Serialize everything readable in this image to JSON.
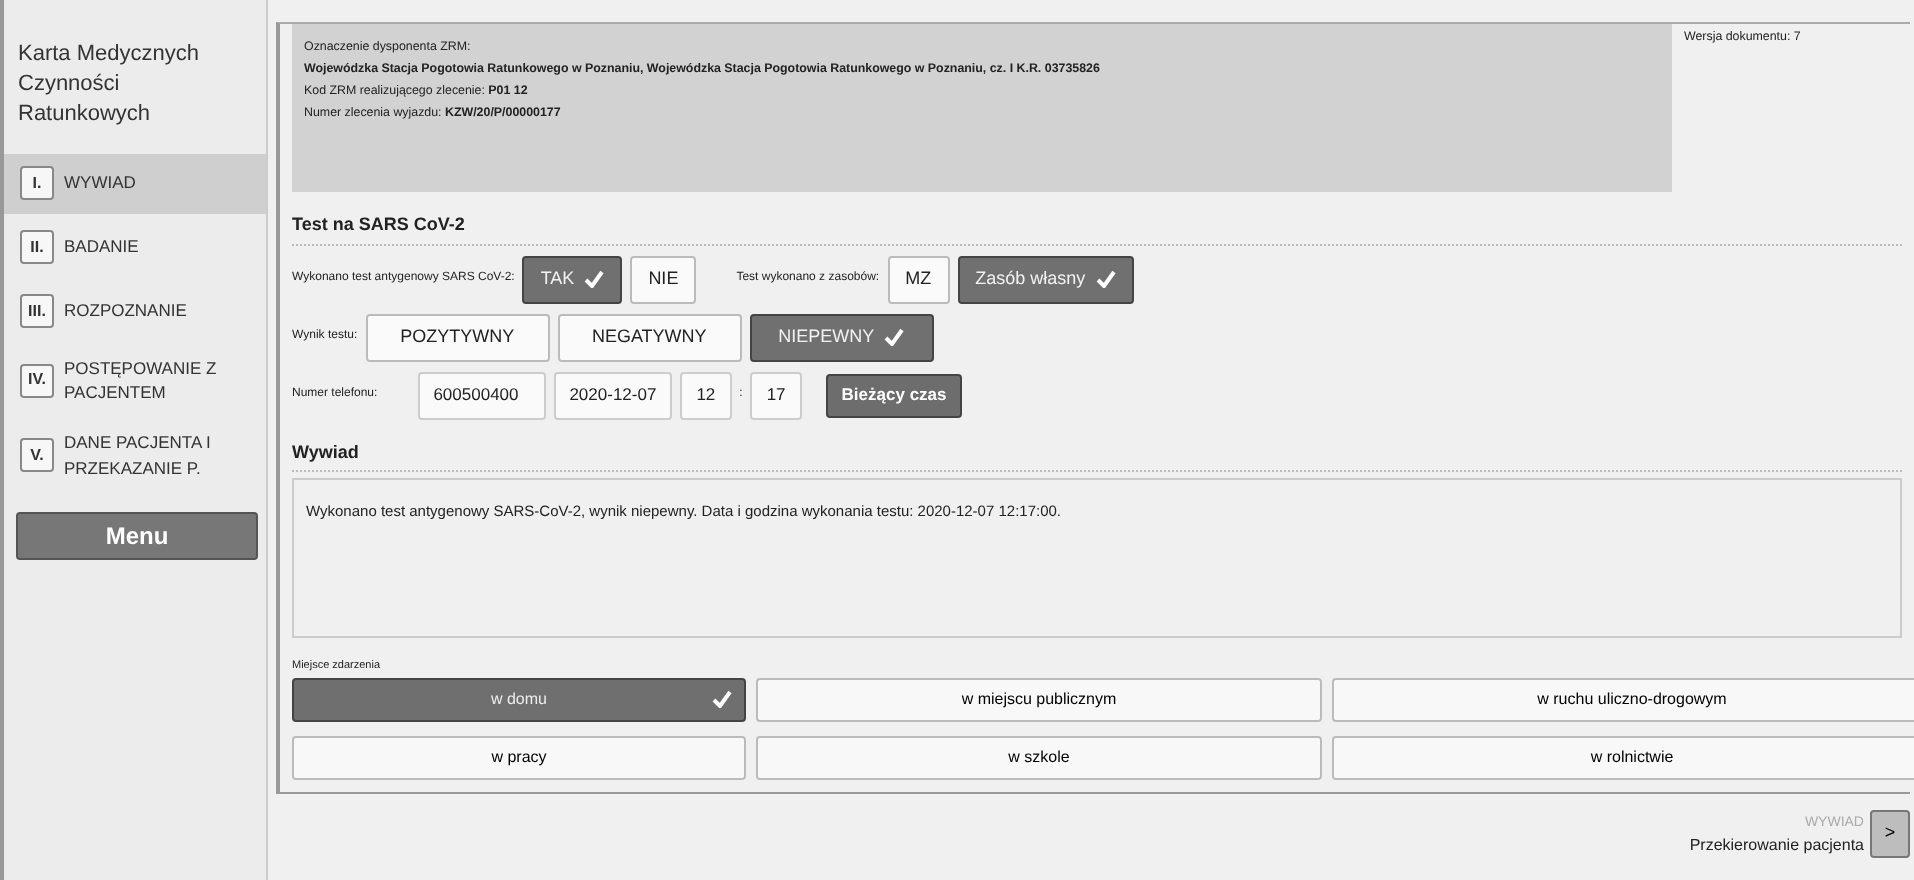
{
  "sidebar": {
    "title": "Karta Medycznych Czynności Ratunkowych",
    "items": [
      {
        "number": "I.",
        "label": "WYWIAD",
        "selected": true
      },
      {
        "number": "II.",
        "label": "BADANIE",
        "selected": false
      },
      {
        "number": "III.",
        "label": "ROZPOZNANIE",
        "selected": false
      },
      {
        "number": "IV.",
        "label": "POSTĘPOWANIE Z PACJENTEM",
        "selected": false
      },
      {
        "number": "V.",
        "label": "DANE PACJENTA I PRZEKAZANIE P.",
        "selected": false
      }
    ],
    "menu_button": "Menu"
  },
  "header": {
    "dispatcher_label": "Oznaczenie dysponenta ZRM:",
    "dispatcher_value": "Wojewódzka Stacja Pogotowia Ratunkowego w Poznaniu, Wojewódzka Stacja Pogotowia Ratunkowego w Poznaniu, cz. I K.R. 03735826",
    "zrm_code_label": "Kod ZRM realizującego zlecenie:",
    "zrm_code_value": "P01 12",
    "order_label": "Numer zlecenia wyjazdu:",
    "order_value": "KZW/20/P/00000177",
    "version": "Wersja dokumentu: 7"
  },
  "test": {
    "title": "Test na SARS CoV-2",
    "antigen_label": "Wykonano test antygenowy SARS CoV-2:",
    "antigen_options": [
      {
        "label": "TAK",
        "selected": true
      },
      {
        "label": "NIE",
        "selected": false
      }
    ],
    "resource_label": "Test wykonano z zasobów:",
    "resource_options": [
      {
        "label": "MZ",
        "selected": false
      },
      {
        "label": "Zasób własny",
        "selected": true
      }
    ],
    "result_label": "Wynik testu:",
    "result_options": [
      {
        "label": "POZYTYWNY",
        "selected": false
      },
      {
        "label": "NEGATYWNY",
        "selected": false
      },
      {
        "label": "NIEPEWNY",
        "selected": true
      }
    ],
    "phone_label": "Numer telefonu:",
    "phone_value": "600500400",
    "date": "2020-12-07",
    "hour": "12",
    "time_separator": ":",
    "minute": "17",
    "current_time_button": "Bieżący czas"
  },
  "interview": {
    "title": "Wywiad",
    "text": "Wykonano test antygenowy SARS-CoV-2, wynik niepewny. Data i godzina wykonania testu: 2020-12-07 12:17:00."
  },
  "location": {
    "label": "Miejsce zdarzenia",
    "options": [
      {
        "label": "w domu",
        "selected": true
      },
      {
        "label": "w miejscu publicznym",
        "selected": false
      },
      {
        "label": "w ruchu uliczno-drogowym",
        "selected": false
      },
      {
        "label": "w pracy",
        "selected": false
      },
      {
        "label": "w szkole",
        "selected": false
      },
      {
        "label": "w rolnictwie",
        "selected": false
      }
    ]
  },
  "footer": {
    "section": "WYWIAD",
    "next_label": "Przekierowanie pacjenta",
    "next_button": ">"
  }
}
